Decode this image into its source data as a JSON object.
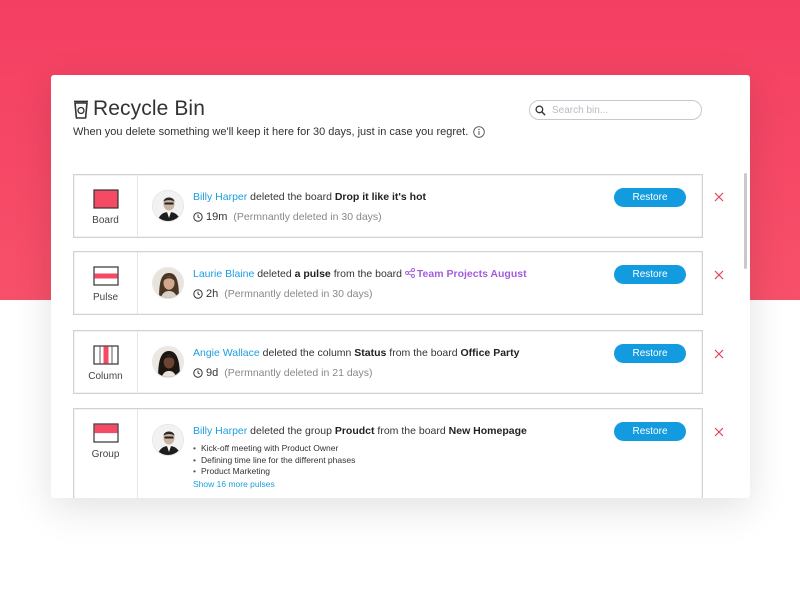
{
  "header": {
    "title": "Recycle Bin",
    "subtitle": "When you delete something we'll keep it here for 30 days,  just in case you regret.",
    "title_icon": "recycle-bin-icon",
    "info_icon": "info-icon"
  },
  "search": {
    "placeholder": "Search bin...",
    "value": ""
  },
  "colors": {
    "accent": "#139be0",
    "user_link": "#1c9ee0",
    "brand_red": "#f43f62",
    "purple": "#a25ddc",
    "close_x": "#e2445c"
  },
  "items": [
    {
      "type_label": "Board",
      "type_icon": "board-icon",
      "user": "Billy Harper",
      "action": " deleted the board ",
      "target": "Drop it like it's hot",
      "age": "19m",
      "perm": "(Permnantly deleted in 30 days)",
      "restore_label": "Restore"
    },
    {
      "type_label": "Pulse",
      "type_icon": "pulse-icon",
      "user": "Laurie Blaine",
      "action": " deleted ",
      "target": "a pulse",
      "action2": " from the board ",
      "board": "Team Projects August",
      "board_icon": "share-icon",
      "age": "2h",
      "perm": "(Permnantly deleted in 30 days)",
      "restore_label": "Restore"
    },
    {
      "type_label": "Column",
      "type_icon": "column-icon",
      "user": "Angie Wallace",
      "action": " deleted the column ",
      "target": "Status",
      "action2": " from the board ",
      "board": "Office Party",
      "age": "9d",
      "perm": "(Permnantly deleted in 21 days)",
      "restore_label": "Restore"
    },
    {
      "type_label": "Group",
      "type_icon": "group-icon",
      "user": "Billy Harper",
      "action": " deleted the group ",
      "target": "Proudct",
      "action2": " from the board ",
      "board": "New Homepage",
      "pulses": [
        "Kick-off meeting with Product Owner",
        "Defining time line for the different phases",
        "Product Marketing"
      ],
      "more_label": "Show 16 more pulses",
      "restore_label": "Restore"
    }
  ]
}
